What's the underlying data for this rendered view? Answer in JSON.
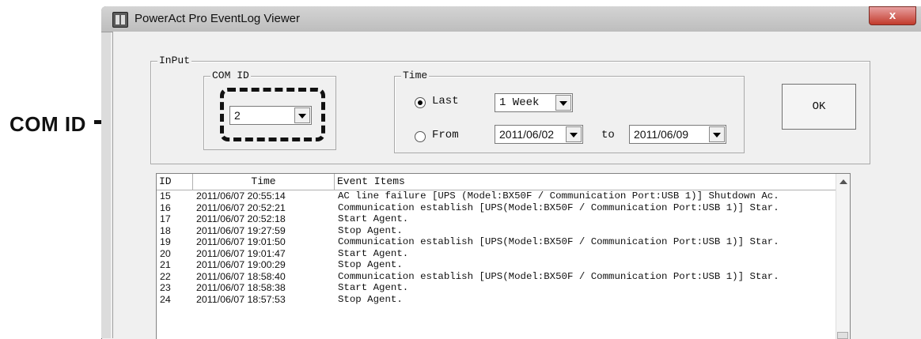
{
  "annotation": {
    "label": "COM ID"
  },
  "window": {
    "title": "PowerAct Pro EventLog Viewer",
    "close": "x"
  },
  "input_group": {
    "label": "InPut",
    "com_id": {
      "label": "COM ID",
      "selected": "2"
    },
    "time": {
      "label": "Time",
      "last": {
        "label": "Last",
        "checked": true,
        "selected": "1 Week"
      },
      "from": {
        "label": "From",
        "checked": false,
        "start": "2011/06/02",
        "to_label": "to",
        "end": "2011/06/09"
      }
    },
    "ok_label": "OK"
  },
  "log": {
    "headers": [
      "ID",
      "Time",
      "Event Items"
    ],
    "rows": [
      {
        "id": "15",
        "time": "2011/06/07 20:55:14",
        "event": "AC line failure [UPS (Model:BX50F / Communication Port:USB 1)] Shutdown Ac."
      },
      {
        "id": "16",
        "time": "2011/06/07 20:52:21",
        "event": "Communication establish [UPS(Model:BX50F / Communication Port:USB 1)] Star."
      },
      {
        "id": "17",
        "time": "2011/06/07 20:52:18",
        "event": "Start Agent."
      },
      {
        "id": "18",
        "time": "2011/06/07 19:27:59",
        "event": "Stop Agent."
      },
      {
        "id": "19",
        "time": "2011/06/07 19:01:50",
        "event": "Communication establish [UPS(Model:BX50F / Communication Port:USB 1)] Star."
      },
      {
        "id": "20",
        "time": "2011/06/07 19:01:47",
        "event": "Start Agent."
      },
      {
        "id": "21",
        "time": "2011/06/07 19:00:29",
        "event": "Stop Agent."
      },
      {
        "id": "22",
        "time": "2011/06/07 18:58:40",
        "event": "Communication establish [UPS(Model:BX50F / Communication Port:USB 1)] Star."
      },
      {
        "id": "23",
        "time": "2011/06/07 18:58:38",
        "event": "Start Agent."
      },
      {
        "id": "24",
        "time": "2011/06/07 18:57:53",
        "event": "Stop Agent."
      }
    ]
  }
}
